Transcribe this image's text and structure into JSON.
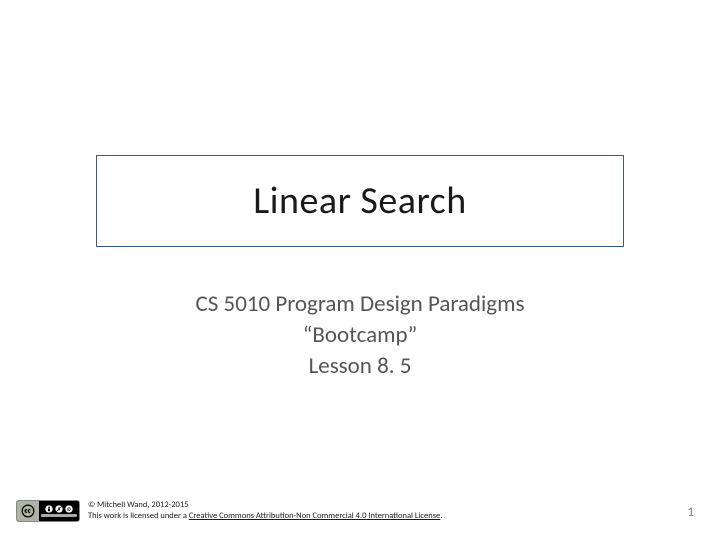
{
  "title": "Linear Search",
  "subtitle_line1": "CS 5010 Program Design Paradigms",
  "subtitle_line2": "“Bootcamp”",
  "subtitle_line3": "Lesson 8. 5",
  "copyright": "© Mitchell Wand, 2012-2015",
  "license_prefix": "This work is licensed under a ",
  "license_link_text": "Creative Commons Attribution-Non Commercial 4.0 International License",
  "license_suffix": ".",
  "page_number": "1",
  "colors": {
    "title_border": "#3b5a8a",
    "subtitle_text": "#555555",
    "page_number_text": "#7a7a7a"
  }
}
